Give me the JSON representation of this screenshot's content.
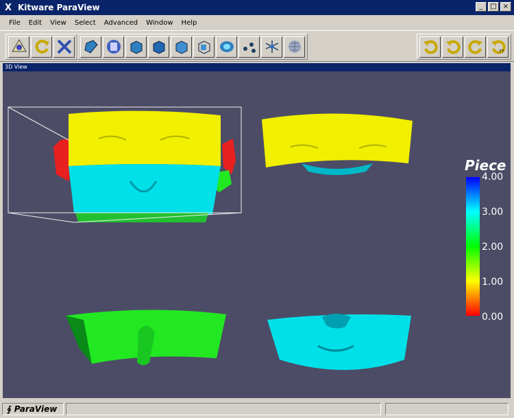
{
  "window": {
    "title": "Kitware ParaView",
    "icon": "X",
    "minimize": "_",
    "maximize": "□",
    "close": "×"
  },
  "menu": [
    "File",
    "Edit",
    "View",
    "Select",
    "Advanced",
    "Window",
    "Help"
  ],
  "toolbar": {
    "left_group": [
      "reset-camera-icon",
      "rotate-icon",
      "translate-icon"
    ],
    "center_group": [
      "clip-icon",
      "calculator-icon",
      "cube-icon",
      "cube-2-icon",
      "cube-3-icon",
      "cube-wire-icon",
      "contour-icon",
      "glyph-icon",
      "stream-icon",
      "mesh-icon"
    ],
    "right_group": [
      "undo-icon",
      "redo-icon",
      "undo-2-icon",
      "redo-2-icon"
    ]
  },
  "view": {
    "title": "3D View"
  },
  "legend": {
    "title": "Piece",
    "ticks": [
      "4.00",
      "3.00",
      "2.00",
      "1.00",
      "0.00"
    ],
    "colors": [
      "#0000ff",
      "#00ffff",
      "#00ff00",
      "#ffff00",
      "#ff0000"
    ]
  },
  "status": {
    "app_name": "ParaView",
    "logo_icon": "∮"
  },
  "colors": {
    "background": "#4c4c66",
    "title_bar": "#0a246a",
    "yellow": "#f0f000",
    "cyan": "#00e0e8",
    "green": "#22e822",
    "red": "#e82020"
  }
}
